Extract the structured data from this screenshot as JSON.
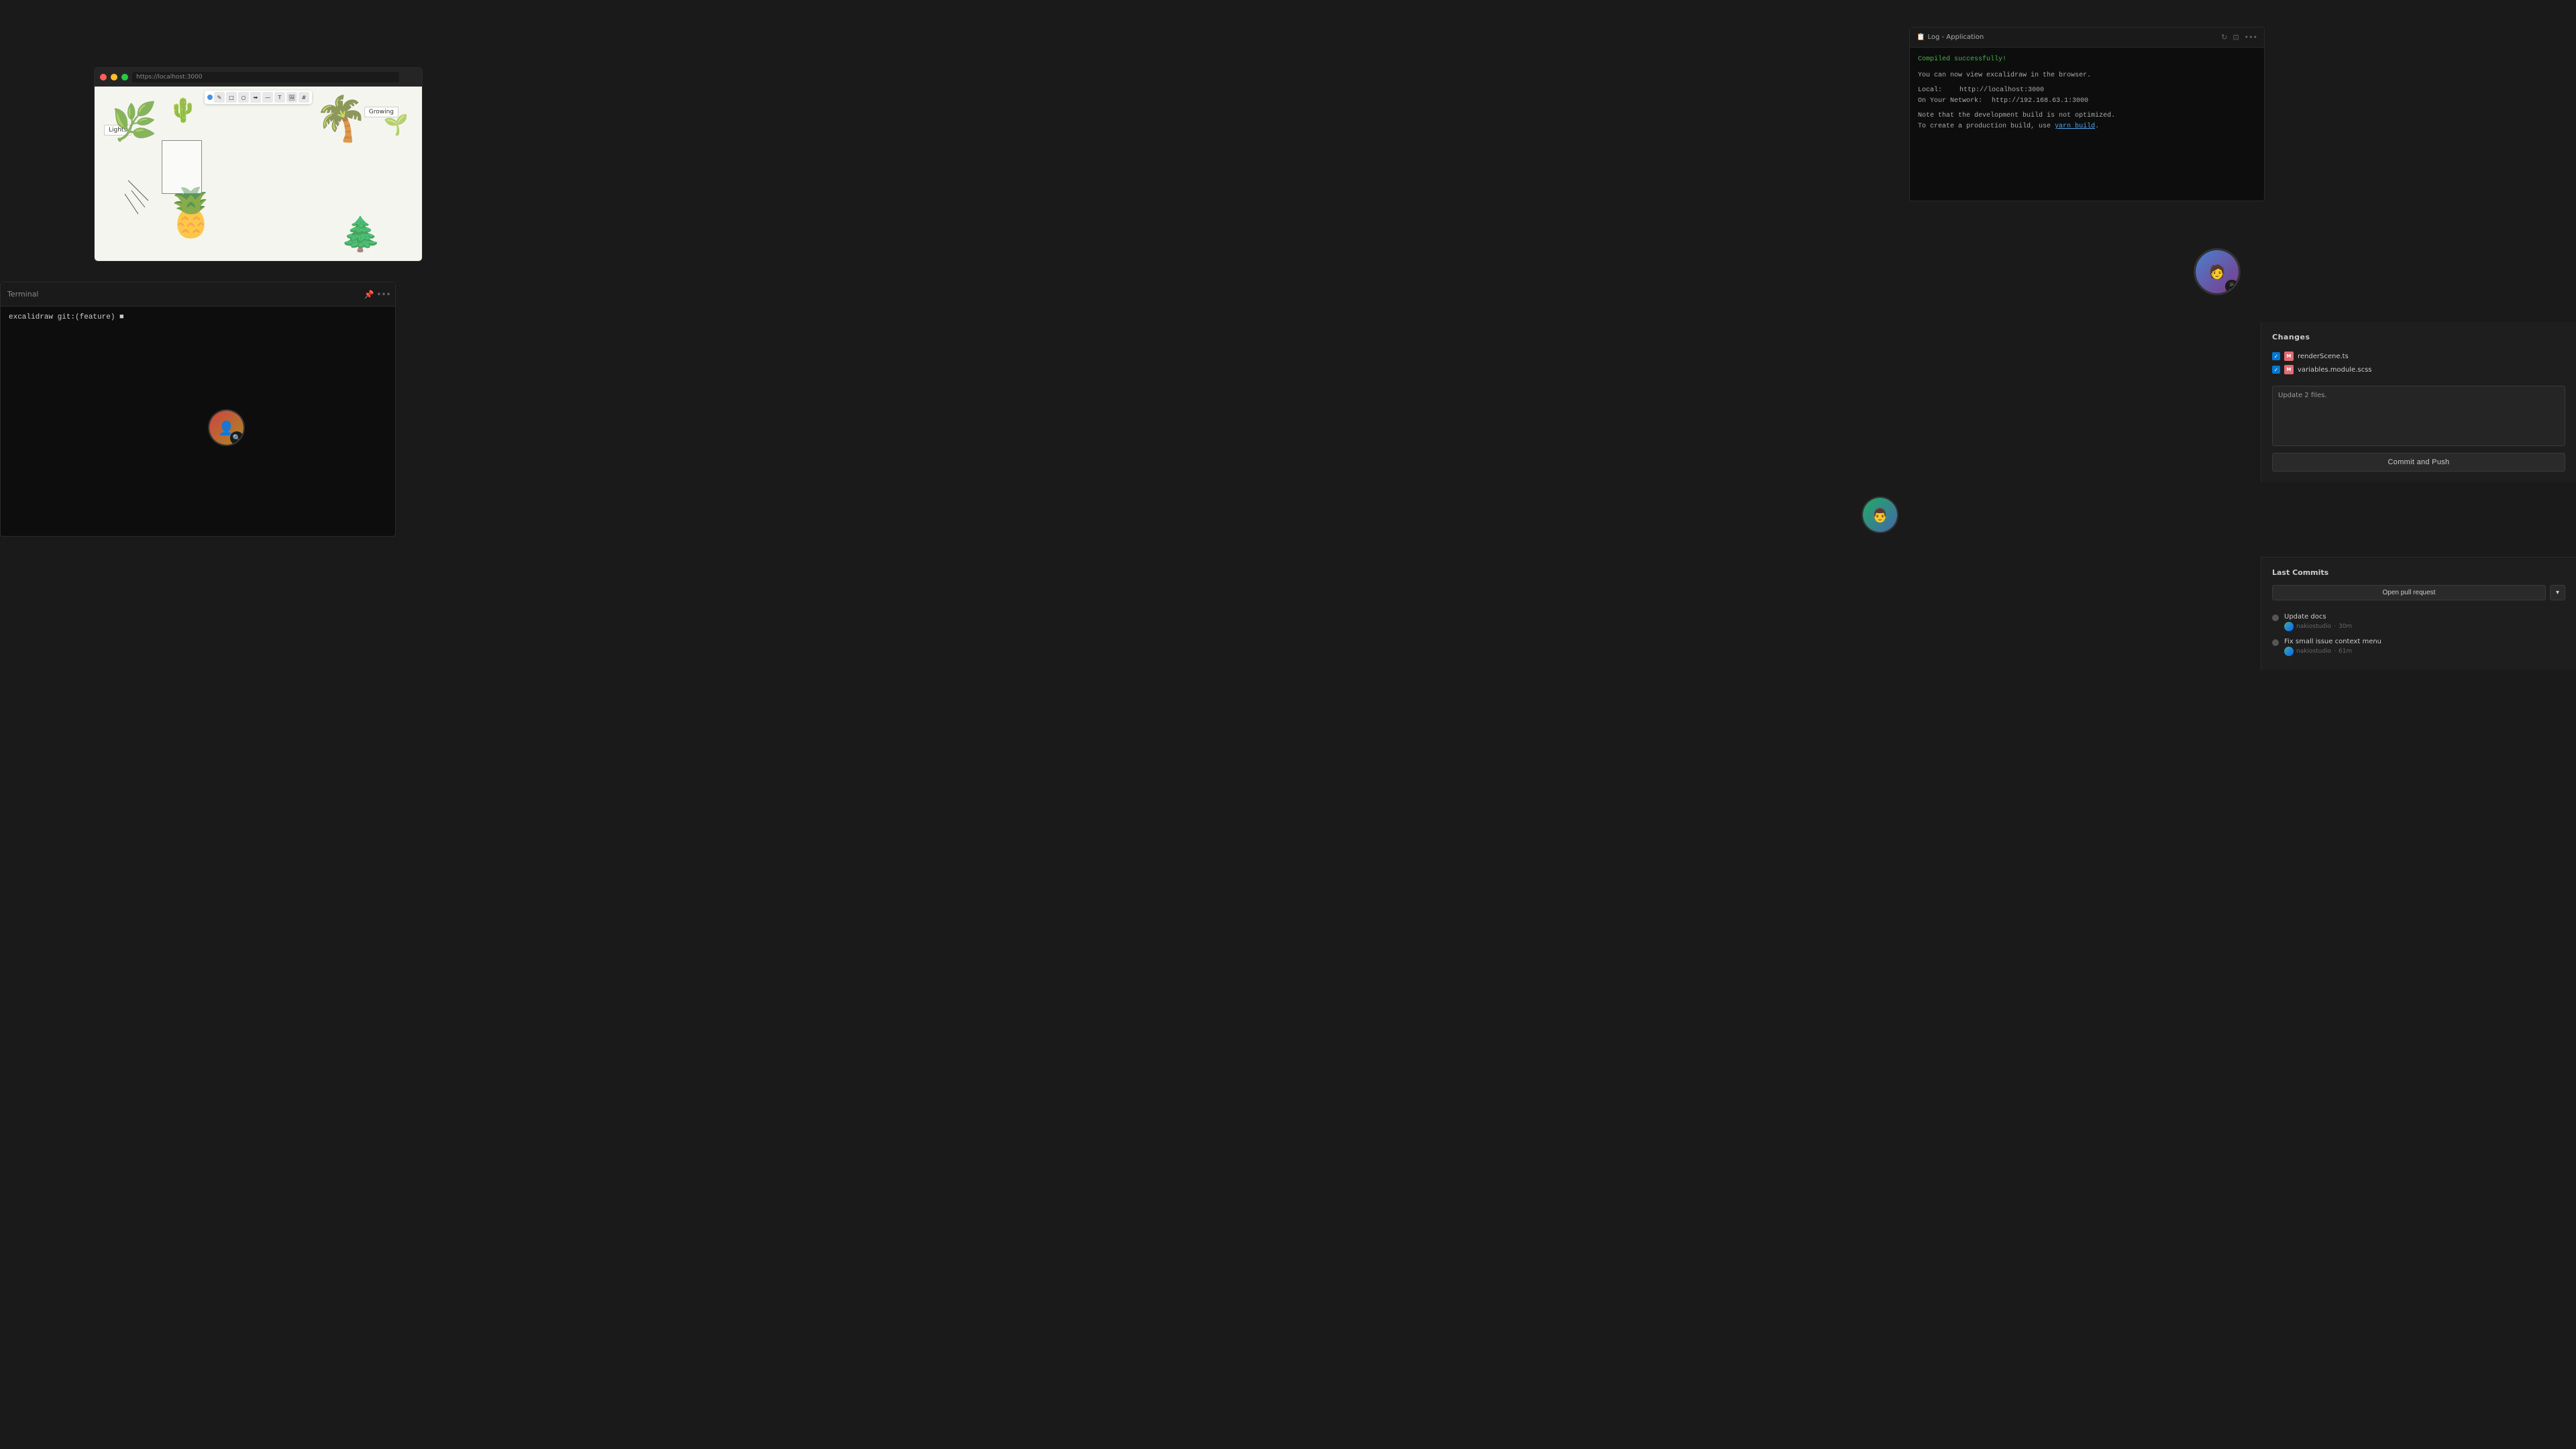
{
  "desktop": {
    "background_color": "#1a1a1a"
  },
  "browser": {
    "url": "https://localhost:3000",
    "controls": [
      "close",
      "minimize",
      "maximize"
    ],
    "canvas_label1": "Lights",
    "canvas_label2": "Growing"
  },
  "terminal": {
    "title": "Terminal",
    "prompt": "excalidraw git:(feature) ■"
  },
  "log_window": {
    "title": "Log - Application",
    "success_msg": "Compiled successfully!",
    "line1": "You can now view excalidraw in the browser.",
    "line2_label": "Local:",
    "line2_value": "http://localhost:3000",
    "line3_label": "On Your Network:",
    "line3_value": "http://192.168.63.1:3000",
    "note1": "Note that the development build is not optimized.",
    "note2_prefix": "To create a production build, use ",
    "note2_link": "yarn build",
    "note2_suffix": "."
  },
  "source_control": {
    "header": "Changes",
    "files": [
      {
        "name": "renderScene.ts",
        "checked": true,
        "icon": "M"
      },
      {
        "name": "variables.module.scss",
        "checked": true,
        "icon": "M"
      }
    ],
    "commit_placeholder": "Update 2 files.",
    "commit_button": "Commit and Push"
  },
  "last_commits": {
    "header": "Last Commits",
    "open_pr_button": "Open pull request",
    "commits": [
      {
        "message": "Update docs",
        "author": "nakiostudio",
        "time": "30m"
      },
      {
        "message": "Fix small issue context menu",
        "author": "nakiostudio",
        "time": "61m"
      }
    ]
  },
  "avatars": [
    {
      "id": "avatar1",
      "position": "right-large",
      "emoji": "🧑"
    },
    {
      "id": "avatar2",
      "position": "bottom-left",
      "emoji": "👤"
    },
    {
      "id": "avatar3",
      "position": "bottom-right",
      "emoji": "👨"
    }
  ],
  "icons": {
    "refresh": "↻",
    "split": "⊡",
    "more": "•••",
    "chevron_down": "▾",
    "check": "✓"
  }
}
